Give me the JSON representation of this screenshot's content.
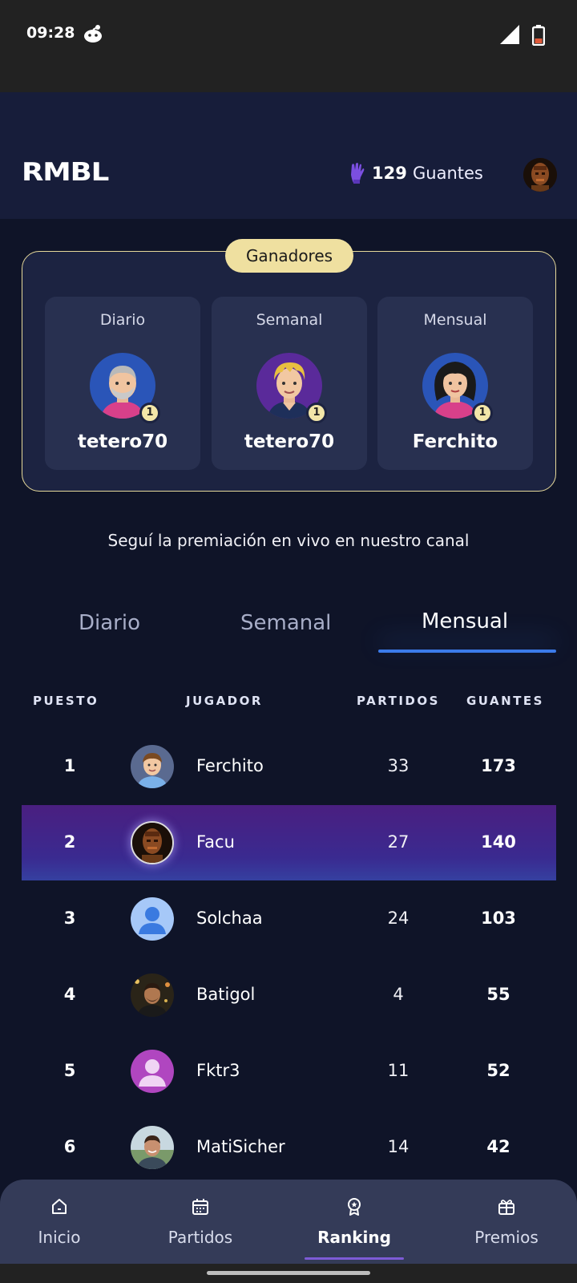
{
  "status_bar": {
    "time": "09:28"
  },
  "header": {
    "logo": "RMBL",
    "coins_count": "129",
    "coins_label": "Guantes"
  },
  "winners": {
    "badge": "Ganadores",
    "items": [
      {
        "period": "Diario",
        "name": "tetero70",
        "medal": "1"
      },
      {
        "period": "Semanal",
        "name": "tetero70",
        "medal": "1"
      },
      {
        "period": "Mensual",
        "name": "Ferchito",
        "medal": "1"
      }
    ]
  },
  "promo_text": "Seguí la premiación en vivo en nuestro canal",
  "tabs": [
    {
      "label": "Diario",
      "active": false
    },
    {
      "label": "Semanal",
      "active": false
    },
    {
      "label": "Mensual",
      "active": true
    }
  ],
  "table": {
    "headers": {
      "rank": "PUESTO",
      "player": "JUGADOR",
      "matches": "PARTIDOS",
      "gloves": "GUANTES"
    },
    "rows": [
      {
        "rank": "1",
        "name": "Ferchito",
        "matches": "33",
        "gloves": "173",
        "highlight": false
      },
      {
        "rank": "2",
        "name": "Facu",
        "matches": "27",
        "gloves": "140",
        "highlight": true
      },
      {
        "rank": "3",
        "name": "Solchaa",
        "matches": "24",
        "gloves": "103",
        "highlight": false
      },
      {
        "rank": "4",
        "name": "Batigol",
        "matches": "4",
        "gloves": "55",
        "highlight": false
      },
      {
        "rank": "5",
        "name": "Fktr3",
        "matches": "11",
        "gloves": "52",
        "highlight": false
      },
      {
        "rank": "6",
        "name": "MatiSicher",
        "matches": "14",
        "gloves": "42",
        "highlight": false
      }
    ]
  },
  "nav": [
    {
      "label": "Inicio",
      "icon": "home-icon",
      "active": false
    },
    {
      "label": "Partidos",
      "icon": "calendar-icon",
      "active": false
    },
    {
      "label": "Ranking",
      "icon": "award-icon",
      "active": true
    },
    {
      "label": "Premios",
      "icon": "gift-icon",
      "active": false
    }
  ],
  "colors": {
    "background": "#0f1428",
    "accent_blue": "#3b7bea",
    "highlight_purple": "#4a1f80",
    "gold": "#efe0a0"
  }
}
